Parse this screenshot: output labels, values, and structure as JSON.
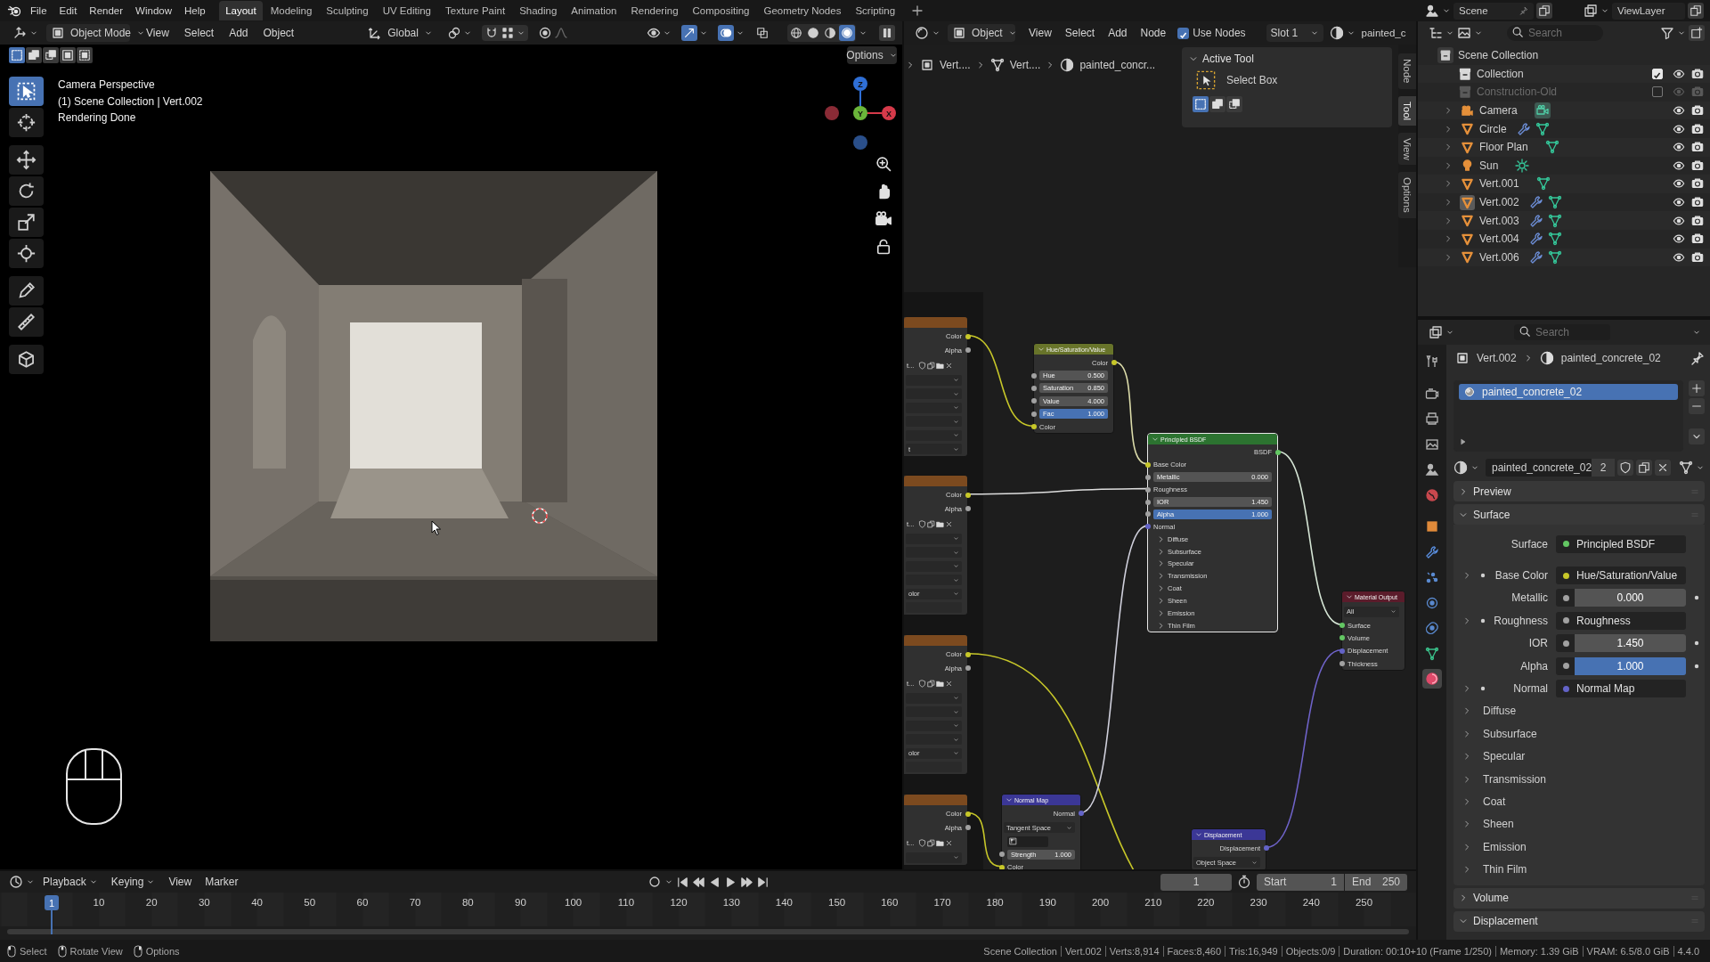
{
  "top_bar": {
    "menus": [
      "File",
      "Edit",
      "Render",
      "Window",
      "Help"
    ],
    "workspaces": [
      {
        "label": "Layout",
        "selected": true
      },
      {
        "label": "Modeling",
        "selected": false
      },
      {
        "label": "Sculpting",
        "selected": false
      },
      {
        "label": "UV Editing",
        "selected": false
      },
      {
        "label": "Texture Paint",
        "selected": false
      },
      {
        "label": "Shading",
        "selected": false
      },
      {
        "label": "Animation",
        "selected": false
      },
      {
        "label": "Rendering",
        "selected": false
      },
      {
        "label": "Compositing",
        "selected": false
      },
      {
        "label": "Geometry Nodes",
        "selected": false
      },
      {
        "label": "Scripting",
        "selected": false
      }
    ],
    "scene": "Scene",
    "view_layer": "ViewLayer"
  },
  "viewport": {
    "mode": "Object Mode",
    "menus": [
      "View",
      "Select",
      "Add",
      "Object"
    ],
    "orientation": "Global",
    "toggles": [
      {
        "kind": "gizmos",
        "on": true
      },
      {
        "kind": "overlays",
        "on": true
      },
      {
        "kind": "xray",
        "on": false
      }
    ],
    "shading": [
      {
        "kind": "wireframe",
        "selected": false
      },
      {
        "kind": "solid",
        "selected": false
      },
      {
        "kind": "material",
        "selected": false
      },
      {
        "kind": "rendered",
        "selected": true
      }
    ],
    "select_modes": [
      {
        "kind": "set",
        "selected": true
      },
      {
        "kind": "extend",
        "selected": false
      },
      {
        "kind": "subtract",
        "selected": false
      },
      {
        "kind": "invert",
        "selected": false
      },
      {
        "kind": "intersect",
        "selected": false
      }
    ],
    "options": "Options",
    "overlay_lines": [
      "Camera Perspective",
      "(1) Scene Collection | Vert.002",
      "Rendering Done"
    ],
    "tools": [
      {
        "kind": "select",
        "selected": true
      },
      {
        "kind": "cursor",
        "selected": false
      },
      {
        "kind": "move",
        "selected": false
      },
      {
        "kind": "rotate",
        "selected": false
      },
      {
        "kind": "scale",
        "selected": false
      },
      {
        "kind": "transform",
        "selected": false
      },
      {
        "kind": "annotate",
        "selected": false
      },
      {
        "kind": "measure",
        "selected": false
      },
      {
        "kind": "add_cube",
        "selected": false
      }
    ],
    "gizmo_axes": [
      "Z",
      "Y",
      "X"
    ]
  },
  "node_editor": {
    "object_type": "Object",
    "menus": [
      "View",
      "Select",
      "Add",
      "Node"
    ],
    "use_nodes": {
      "label": "Use Nodes",
      "checked": true
    },
    "slot": "Slot 1",
    "material": "painted_c",
    "breadcrumbs": [
      "Vert....",
      "Vert....",
      "painted_concr..."
    ],
    "sidebar": {
      "title": "Active Tool",
      "tool": "Select Box",
      "tabs": [
        {
          "label": "Node",
          "selected": false
        },
        {
          "label": "Tool",
          "selected": true
        },
        {
          "label": "View",
          "selected": false
        },
        {
          "label": "Options",
          "selected": false
        }
      ]
    },
    "nodes": [
      {
        "kind": "image",
        "selected": false,
        "rows": [
          {
            "kind": "output",
            "label": "Color",
            "color": "#c7c729"
          },
          {
            "kind": "output",
            "label": "Alpha",
            "color": "#a1a1a1"
          },
          {
            "kind": "image",
            "value": "t..."
          },
          {
            "kind": "dropdown"
          },
          {
            "kind": "dropdown"
          },
          {
            "kind": "dropdown"
          },
          {
            "kind": "dropdown"
          },
          {
            "kind": "dropdown"
          },
          {
            "kind": "dropdown",
            "value": "t"
          }
        ]
      },
      {
        "kind": "image",
        "selected": false,
        "rows": [
          {
            "kind": "output",
            "label": "Color",
            "color": "#c7c729"
          },
          {
            "kind": "output",
            "label": "Alpha",
            "color": "#a1a1a1"
          },
          {
            "kind": "image",
            "value": "t..."
          },
          {
            "kind": "dropdown"
          },
          {
            "kind": "dropdown"
          },
          {
            "kind": "dropdown"
          },
          {
            "kind": "dropdown"
          },
          {
            "kind": "dropdown",
            "value": "olor"
          },
          {
            "kind": "field"
          }
        ]
      },
      {
        "kind": "image",
        "selected": false,
        "rows": [
          {
            "kind": "output",
            "label": "Color",
            "color": "#c7c729"
          },
          {
            "kind": "output",
            "label": "Alpha",
            "color": "#a1a1a1"
          },
          {
            "kind": "image",
            "value": "t..."
          },
          {
            "kind": "dropdown"
          },
          {
            "kind": "dropdown"
          },
          {
            "kind": "dropdown"
          },
          {
            "kind": "dropdown"
          },
          {
            "kind": "dropdown",
            "value": "olor"
          },
          {
            "kind": "field"
          }
        ]
      },
      {
        "kind": "image",
        "selected": false,
        "rows": [
          {
            "kind": "output",
            "label": "Color",
            "color": "#c7c729"
          },
          {
            "kind": "output",
            "label": "Alpha",
            "color": "#a1a1a1"
          },
          {
            "kind": "image",
            "value": "t..."
          },
          {
            "kind": "dropdown"
          }
        ]
      },
      {
        "kind": "hsv",
        "title": "Hue/Saturation/Value",
        "selected": false,
        "rows": [
          {
            "kind": "output",
            "label": "Color",
            "color": "#c7c729"
          },
          {
            "kind": "number",
            "label": "Hue",
            "value": "0.500",
            "color": "#a1a1a1"
          },
          {
            "kind": "number",
            "label": "Saturation",
            "value": "0.850",
            "color": "#a1a1a1"
          },
          {
            "kind": "number",
            "label": "Value",
            "value": "4.000",
            "color": "#a1a1a1"
          },
          {
            "kind": "slider",
            "label": "Fac",
            "value": "1.000",
            "level": 1,
            "color": "#a1a1a1"
          },
          {
            "kind": "input",
            "label": "Color",
            "color": "#c7c729"
          }
        ]
      },
      {
        "kind": "bsdf",
        "title": "Principled BSDF",
        "selected": true,
        "rows": [
          {
            "kind": "output",
            "label": "BSDF",
            "color": "#63c763"
          },
          {
            "kind": "input",
            "label": "Base Color",
            "color": "#c7c729"
          },
          {
            "kind": "number",
            "label": "Metallic",
            "value": "0.000",
            "color": "#a1a1a1"
          },
          {
            "kind": "input",
            "label": "Roughness",
            "color": "#a1a1a1"
          },
          {
            "kind": "number",
            "label": "IOR",
            "value": "1.450",
            "color": "#a1a1a1"
          },
          {
            "kind": "slider",
            "label": "Alpha",
            "value": "1.000",
            "level": 1,
            "color": "#a1a1a1"
          },
          {
            "kind": "input",
            "label": "Normal",
            "color": "#6363c7"
          },
          {
            "kind": "panel",
            "label": "Diffuse",
            "expanded": false
          },
          {
            "kind": "panel",
            "label": "Subsurface",
            "expanded": false
          },
          {
            "kind": "panel",
            "label": "Specular",
            "expanded": false
          },
          {
            "kind": "panel",
            "label": "Transmission",
            "expanded": false
          },
          {
            "kind": "panel",
            "label": "Coat",
            "expanded": false
          },
          {
            "kind": "panel",
            "label": "Sheen",
            "expanded": false
          },
          {
            "kind": "panel",
            "label": "Emission",
            "expanded": false
          },
          {
            "kind": "panel",
            "label": "Thin Film",
            "expanded": false
          }
        ]
      },
      {
        "kind": "output",
        "title": "Material Output",
        "selected": false,
        "rows": [
          {
            "kind": "dropdown",
            "value": "All"
          },
          {
            "kind": "input",
            "label": "Surface",
            "color": "#63c763"
          },
          {
            "kind": "input",
            "label": "Volume",
            "color": "#63c763"
          },
          {
            "kind": "input",
            "label": "Displacement",
            "color": "#6363c7"
          },
          {
            "kind": "input",
            "label": "Thickness",
            "color": "#a1a1a1"
          }
        ]
      },
      {
        "kind": "normal_map",
        "title": "Normal Map",
        "selected": false,
        "rows": [
          {
            "kind": "output",
            "label": "Normal",
            "color": "#6363c7"
          },
          {
            "kind": "dropdown",
            "value": "Tangent Space"
          },
          {
            "kind": "uv_field"
          },
          {
            "kind": "number",
            "label": "Strength",
            "value": "1.000",
            "color": "#a1a1a1"
          },
          {
            "kind": "input",
            "label": "Color",
            "color": "#c7c729"
          }
        ]
      },
      {
        "kind": "displacement",
        "title": "Displacement",
        "selected": false,
        "rows": [
          {
            "kind": "output",
            "label": "Displacement",
            "color": "#6363c7"
          },
          {
            "kind": "dropdown",
            "value": "Object Space"
          }
        ]
      }
    ]
  },
  "outliner": {
    "search_placeholder": "Search",
    "root": {
      "name": "Scene Collection",
      "collections": [
        {
          "name": "Collection",
          "checked": true
        },
        {
          "name": "Construction-Old",
          "checked": false
        }
      ],
      "objects": [
        {
          "name": "Camera",
          "kind": "camera",
          "expanded": false,
          "selected": false,
          "modifier": false
        },
        {
          "name": "Circle",
          "kind": "mesh",
          "expanded": false,
          "selected": false,
          "modifier": true
        },
        {
          "name": "Floor Plan",
          "kind": "mesh",
          "expanded": false,
          "selected": false,
          "modifier": false
        },
        {
          "name": "Sun",
          "kind": "light",
          "expanded": false,
          "selected": false,
          "modifier": false
        },
        {
          "name": "Vert.001",
          "kind": "mesh",
          "expanded": false,
          "selected": false,
          "modifier": false
        },
        {
          "name": "Vert.002",
          "kind": "mesh",
          "expanded": false,
          "selected": true,
          "modifier": true
        },
        {
          "name": "Vert.003",
          "kind": "mesh",
          "expanded": false,
          "selected": false,
          "modifier": true
        },
        {
          "name": "Vert.004",
          "kind": "mesh",
          "expanded": false,
          "selected": false,
          "modifier": true
        },
        {
          "name": "Vert.006",
          "kind": "mesh",
          "expanded": false,
          "selected": false,
          "modifier": true
        }
      ]
    }
  },
  "properties": {
    "search_placeholder": "Search",
    "tabs": [
      {
        "kind": "tool",
        "selected": false
      },
      {
        "kind": "render",
        "selected": false
      },
      {
        "kind": "output",
        "selected": false
      },
      {
        "kind": "view_layer",
        "selected": false
      },
      {
        "kind": "scene",
        "selected": false
      },
      {
        "kind": "world",
        "selected": false
      },
      {
        "kind": "object",
        "selected": false
      },
      {
        "kind": "modifiers",
        "selected": false
      },
      {
        "kind": "particles",
        "selected": false
      },
      {
        "kind": "physics",
        "selected": false
      },
      {
        "kind": "constraints",
        "selected": false
      },
      {
        "kind": "data",
        "selected": false
      },
      {
        "kind": "material",
        "selected": true
      }
    ],
    "breadcrumbs": [
      "Vert.002",
      "painted_concrete_02"
    ],
    "slots": [
      {
        "name": "painted_concrete_02",
        "selected": true
      }
    ],
    "material": {
      "name": "painted_concrete_02",
      "users": "2"
    },
    "panels": [
      {
        "title": "Preview",
        "expanded": false
      },
      {
        "title": "Surface",
        "expanded": true,
        "rows": [
          {
            "kind": "link",
            "label": "Surface",
            "value": "Principled BSDF",
            "color": "#63c763"
          },
          {
            "kind": "link",
            "label": "Base Color",
            "value": "Hue/Saturation/Value",
            "color": "#c7c729",
            "expanded": false
          },
          {
            "kind": "number",
            "label": "Metallic",
            "value": "0.000",
            "color": "#a1a1a1"
          },
          {
            "kind": "link",
            "label": "Roughness",
            "value": "Roughness",
            "color": "#a1a1a1",
            "expanded": false
          },
          {
            "kind": "number",
            "label": "IOR",
            "value": "1.450",
            "color": "#a1a1a1"
          },
          {
            "kind": "slider",
            "label": "Alpha",
            "value": "1.000",
            "level": 1,
            "color": "#a1a1a1"
          },
          {
            "kind": "link",
            "label": "Normal",
            "value": "Normal Map",
            "color": "#6363c7",
            "expanded": false
          },
          {
            "kind": "subpanel",
            "label": "Diffuse",
            "expanded": false
          },
          {
            "kind": "subpanel",
            "label": "Subsurface",
            "expanded": false
          },
          {
            "kind": "subpanel",
            "label": "Specular",
            "expanded": false
          },
          {
            "kind": "subpanel",
            "label": "Transmission",
            "expanded": false
          },
          {
            "kind": "subpanel",
            "label": "Coat",
            "expanded": false
          },
          {
            "kind": "subpanel",
            "label": "Sheen",
            "expanded": false
          },
          {
            "kind": "subpanel",
            "label": "Emission",
            "expanded": false
          },
          {
            "kind": "subpanel",
            "label": "Thin Film",
            "expanded": false
          }
        ]
      },
      {
        "title": "Volume",
        "expanded": false
      },
      {
        "title": "Displacement",
        "expanded": true
      }
    ]
  },
  "timeline": {
    "menus": [
      {
        "label": "Playback",
        "dropdown": true
      },
      {
        "label": "Keying",
        "dropdown": true
      },
      {
        "label": "View",
        "dropdown": false
      },
      {
        "label": "Marker",
        "dropdown": false
      }
    ],
    "current_frame": "1",
    "start_label": "Start",
    "start": "1",
    "end_label": "End",
    "end": "250",
    "playhead": "1",
    "ticks": [
      "10",
      "20",
      "30",
      "40",
      "50",
      "60",
      "70",
      "80",
      "90",
      "100",
      "110",
      "120",
      "130",
      "140",
      "150",
      "160",
      "170",
      "180",
      "190",
      "200",
      "210",
      "220",
      "230",
      "240",
      "250"
    ]
  },
  "status_bar": {
    "hints": [
      {
        "kind": "left",
        "label": "Select"
      },
      {
        "kind": "middle",
        "label": "Rotate View"
      },
      {
        "kind": "right",
        "label": "Options"
      }
    ],
    "stats": [
      "Scene Collection",
      "Vert.002",
      "Verts:8,914",
      "Faces:8,460",
      "Tris:16,949",
      "Objects:0/9",
      "Duration: 00:10+10 (Frame 1/250)",
      "Memory: 1.39 GiB",
      "VRAM: 6.5/8.0 GiB",
      "4.4.0"
    ]
  }
}
